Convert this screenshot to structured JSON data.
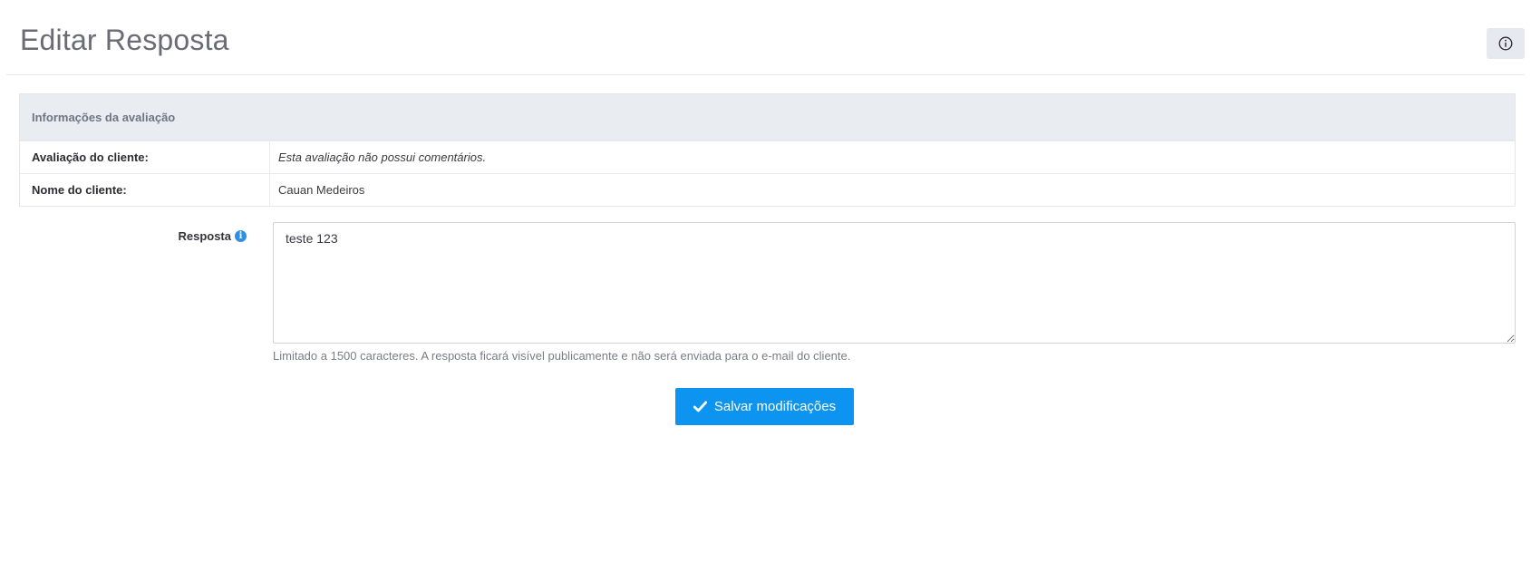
{
  "header": {
    "title": "Editar Resposta",
    "info_icon": "info-circle-icon"
  },
  "review_info": {
    "section_title": "Informações da avaliação",
    "rows": [
      {
        "label": "Avaliação do cliente:",
        "value": "Esta avaliação não possui comentários."
      },
      {
        "label": "Nome do cliente:",
        "value": "Cauan Medeiros"
      }
    ]
  },
  "response_form": {
    "label": "Resposta",
    "help_icon": "info-icon",
    "value": "teste 123",
    "help_text": "Limitado a 1500 caracteres. A resposta ficará visível publicamente e não será enviada para o e-mail do cliente."
  },
  "actions": {
    "save_label": "Salvar modificações",
    "save_icon": "check-icon"
  },
  "colors": {
    "accent": "#0d94f0",
    "table_header_bg": "#e9ecf1",
    "help_icon": "#2d8fe6"
  }
}
